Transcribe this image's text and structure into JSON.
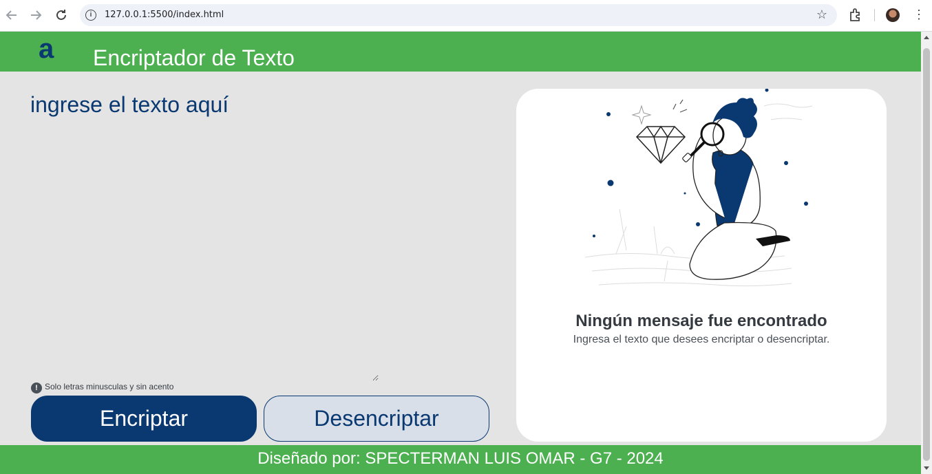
{
  "browser": {
    "url": "127.0.0.1:5500/index.html"
  },
  "header": {
    "logo_letter": "a",
    "title": "Encriptador de Texto"
  },
  "input": {
    "placeholder": "ingrese el texto aquí",
    "hint": "Solo letras minusculas y sin acento"
  },
  "buttons": {
    "encrypt": "Encriptar",
    "decrypt": "Desencriptar"
  },
  "output": {
    "title": "Ningún mensaje fue encontrado",
    "subtitle": "Ingresa el texto que desees encriptar o desencriptar."
  },
  "footer": {
    "text": "Diseñado por: SPECTERMAN LUIS OMAR - G7 - 2024"
  },
  "colors": {
    "green": "#4caf50",
    "navy": "#0a3871",
    "background": "#e4e4e4"
  }
}
